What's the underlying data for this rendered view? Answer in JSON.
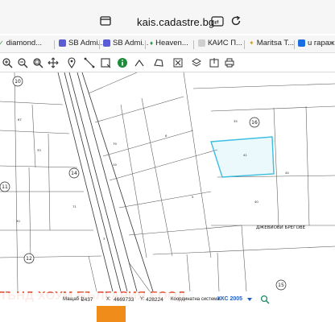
{
  "browser": {
    "url": "kais.cadastre.bg",
    "bookmarks": [
      {
        "label": "diamond...",
        "color": "#3a8f3a"
      },
      {
        "label": "SB Admi...",
        "color": "#5b5bd6"
      },
      {
        "label": "SB Admi...",
        "color": "#5b5bd6"
      },
      {
        "label": "Heaven...",
        "color": "#2e9a3c"
      },
      {
        "label": "КАИС П...",
        "color": "#777777"
      },
      {
        "label": "Maritsa T...",
        "color": "#c9a227"
      },
      {
        "label": "u гараж...",
        "color": "#1a6fe0"
      }
    ]
  },
  "map": {
    "ring_labels": [
      "10",
      "16",
      "11",
      "14",
      "12",
      "15"
    ],
    "parcel_numbers": [
      "67",
      "79",
      "6",
      "19",
      "33",
      "5",
      "41",
      "44",
      "40",
      "71",
      "3",
      "35",
      "30"
    ],
    "street_name": "ДЖЕВИОВИ БРЕГОВЕ",
    "selected_color": "#3bbfe0"
  },
  "watermark": "ЛЪНД ХОУМ БЪЛГАРИЯ ЕООД",
  "status": {
    "scale_label": "Мащаб 1:",
    "scale_value": "2437",
    "x_label": "X:",
    "x_value": "4669733",
    "y_label": "Y:",
    "y_value": "428224",
    "coord_system_label": "Координатна система:",
    "coord_system_value": "ККС 2005"
  }
}
